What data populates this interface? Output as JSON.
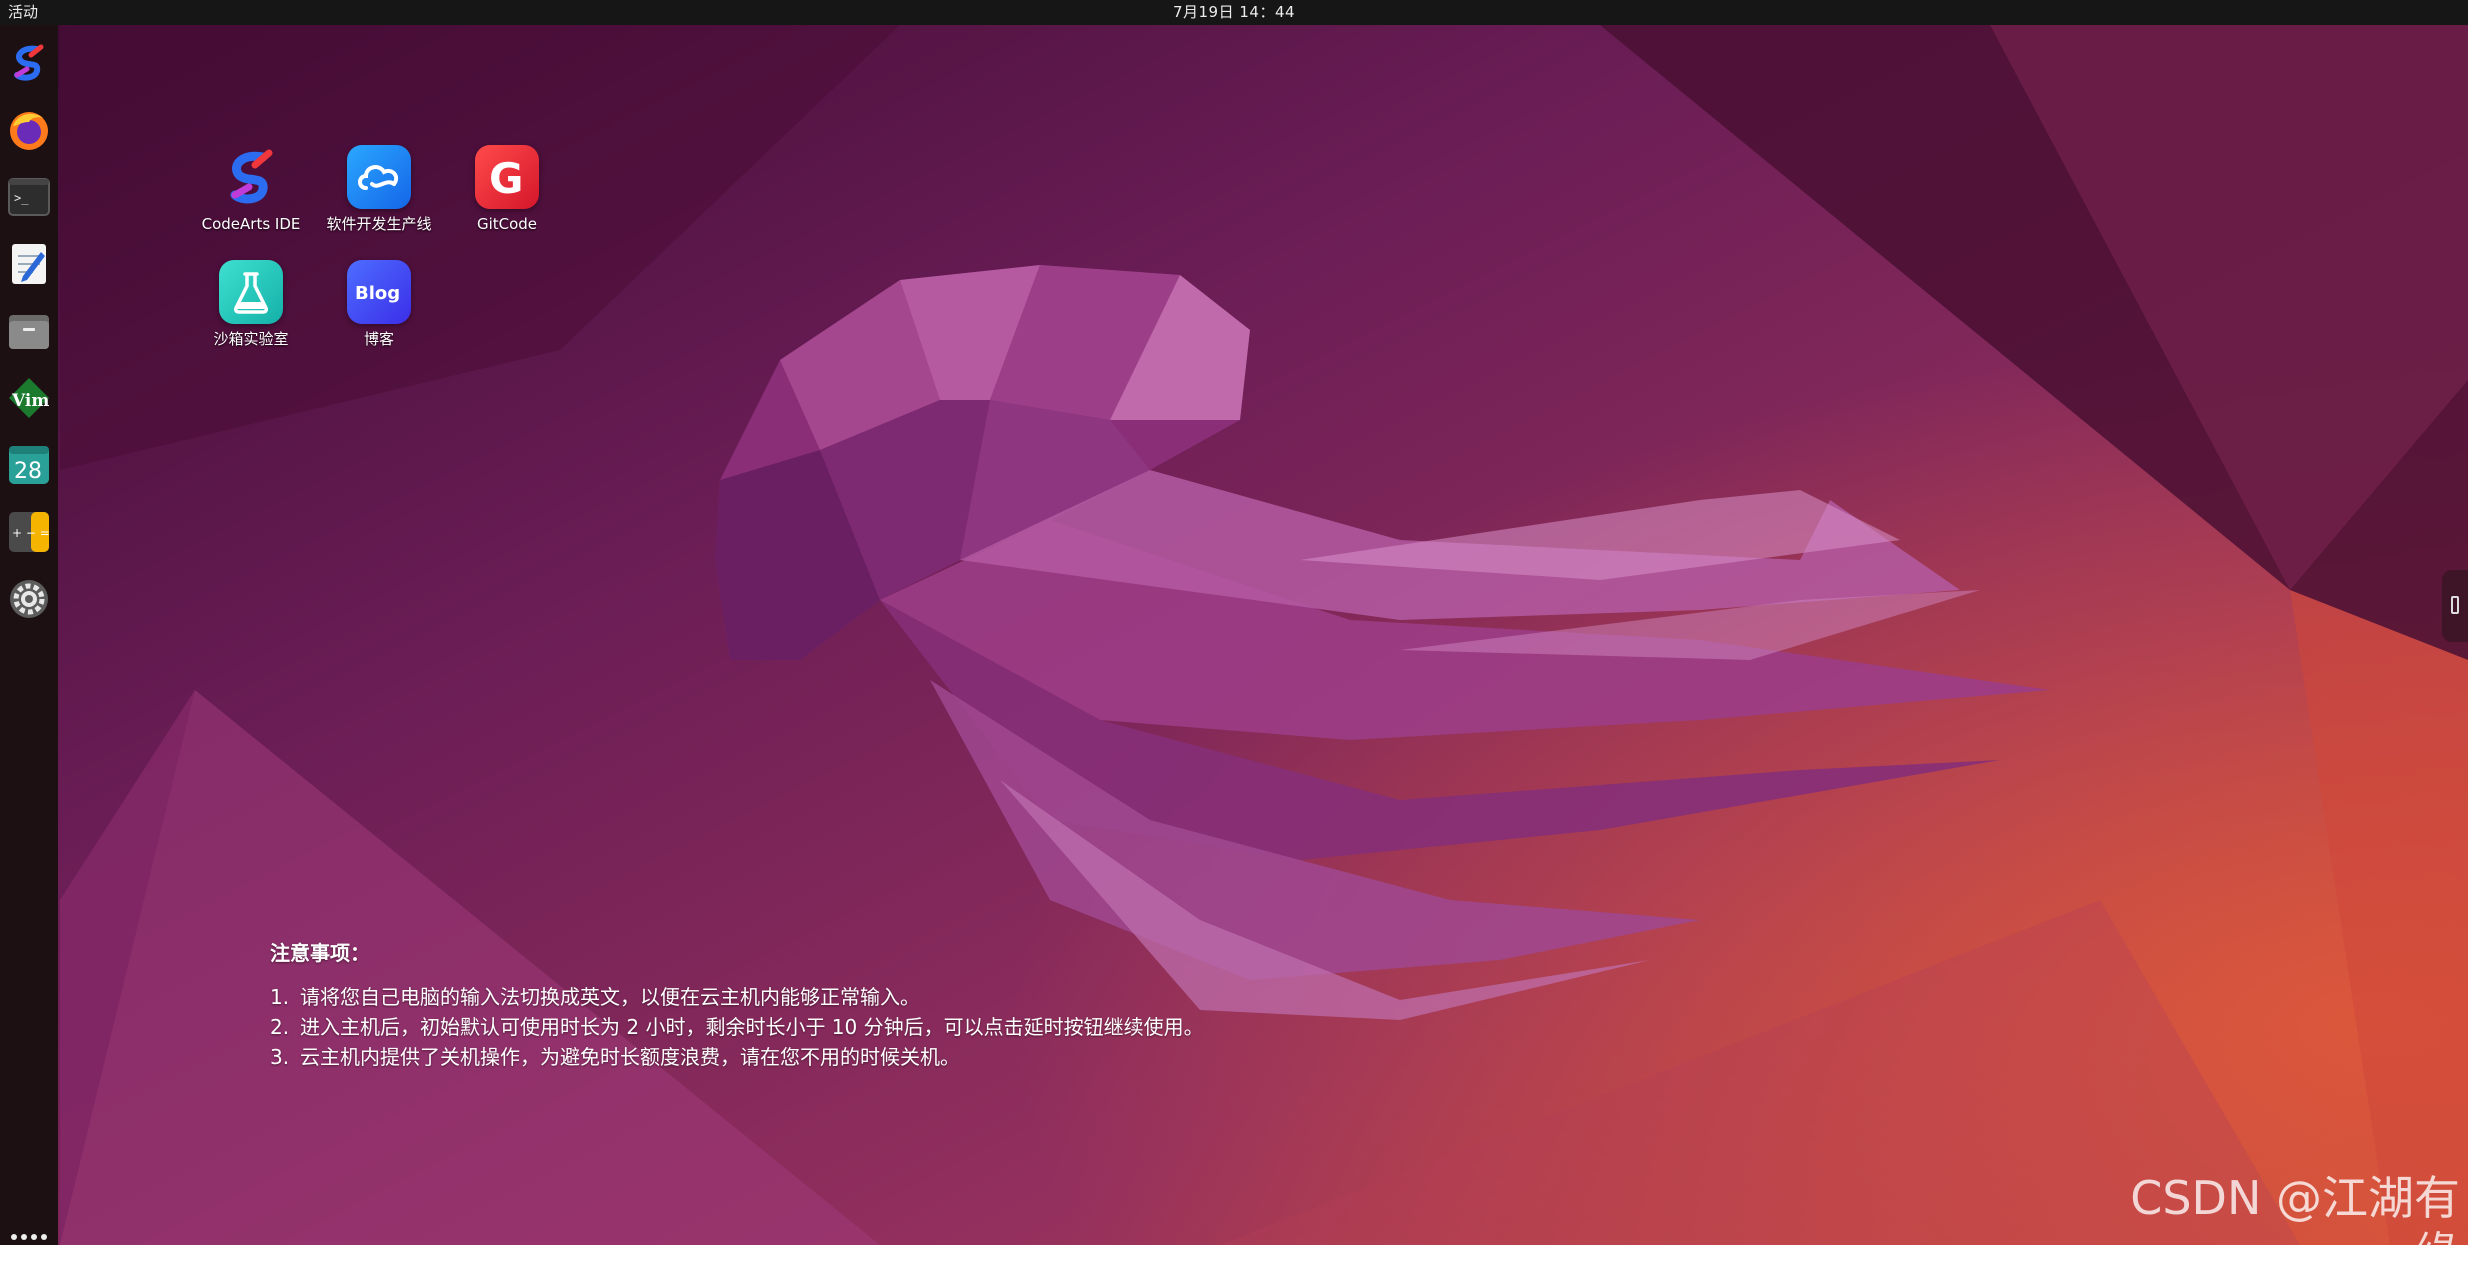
{
  "topbar": {
    "activities_label": "活动",
    "clock": "7月19日 14：44"
  },
  "dock": {
    "items": [
      {
        "name": "codearts-ide",
        "icon": "codearts-icon"
      },
      {
        "name": "firefox",
        "icon": "firefox-icon"
      },
      {
        "name": "terminal",
        "icon": "terminal-icon",
        "glyph": ">_"
      },
      {
        "name": "text-editor",
        "icon": "text-editor-icon"
      },
      {
        "name": "files",
        "icon": "files-icon"
      },
      {
        "name": "vim",
        "icon": "vim-icon",
        "glyph": "Vim"
      },
      {
        "name": "calendar",
        "icon": "calendar-icon",
        "day": "28"
      },
      {
        "name": "calculator",
        "icon": "calculator-icon",
        "glyph": "+ − ="
      },
      {
        "name": "settings",
        "icon": "gear-icon"
      }
    ],
    "show_apps_icon": "grid-dots-icon"
  },
  "desktop": {
    "icons": [
      {
        "label": "CodeArts IDE",
        "icon": "codearts-icon"
      },
      {
        "label": "软件开发生产线",
        "icon": "cloud-icon"
      },
      {
        "label": "GitCode",
        "icon": "gitcode-icon",
        "glyph": "G"
      },
      {
        "label": "沙箱实验室",
        "icon": "flask-icon"
      },
      {
        "label": "博客",
        "icon": "blog-icon",
        "glyph": "Blog"
      }
    ]
  },
  "notice": {
    "title": "注意事项：",
    "items": [
      {
        "num": "1.",
        "text": "请将您自己电脑的输入法切换成英文，以便在云主机内能够正常输入。"
      },
      {
        "num": "2.",
        "text": "进入主机后，初始默认可使用时长为 2 小时，剩余时长小于 10 分钟后，可以点击延时按钮继续使用。"
      },
      {
        "num": "3.",
        "text": "云主机内提供了关机操作，为避免时长额度浪费，请在您不用的时候关机。"
      }
    ]
  },
  "watermark": "CSDN @江湖有缘",
  "colors": {
    "accent": "#e95420",
    "wallpaper_dark": "#3c0a2c",
    "wallpaper_mid": "#8a2a6a",
    "wallpaper_warm": "#d8503f",
    "topbar": "#161616",
    "dock": "#1c1013"
  }
}
